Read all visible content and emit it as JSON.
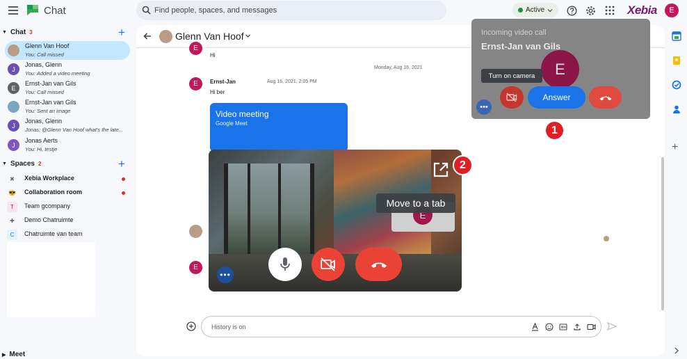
{
  "app": {
    "title": "Chat"
  },
  "search": {
    "placeholder": "Find people, spaces, and messages"
  },
  "status": {
    "label": "Active"
  },
  "brand": {
    "name": "Xebia"
  },
  "account": {
    "initial": "E"
  },
  "sidebar": {
    "chat": {
      "label": "Chat",
      "count": "3"
    },
    "chats": [
      {
        "name": "Glenn Van Hoof",
        "preview": "You: Call missed",
        "color": "#b89c84",
        "initial": ""
      },
      {
        "name": "Jonas, Glenn",
        "preview": "You: Added a video meeting",
        "color": "#6a4fb5",
        "initial": "J"
      },
      {
        "name": "Ernst-Jan van Gils",
        "preview": "You: Call missed",
        "color": "#5f6368",
        "initial": "E"
      },
      {
        "name": "Ernst-Jan van Gils",
        "preview": "You: Sent an image",
        "color": "#7aa6c2",
        "initial": ""
      },
      {
        "name": "Jonas, Glenn",
        "preview": "Jonas: @Glenn Van Hoof what's the late...",
        "color": "#6a4fb5",
        "initial": "J"
      },
      {
        "name": "Jonas Aerts",
        "preview": "You: Hi, testje",
        "color": "#7e57c2",
        "initial": "J"
      }
    ],
    "spaces": {
      "label": "Spaces",
      "count": "2"
    },
    "space_items": [
      {
        "name": "Xebia Workplace",
        "icon": "✖",
        "bg": "transparent",
        "fg": "#5f6368",
        "bold": true,
        "unread": true
      },
      {
        "name": "Collaboration room",
        "icon": "😎",
        "bg": "transparent",
        "fg": "#000",
        "bold": true,
        "unread": true
      },
      {
        "name": "Team gcompany",
        "icon": "T",
        "bg": "#fce4ec",
        "fg": "#c2185b",
        "bold": false,
        "unread": false
      },
      {
        "name": "Demo Chatruimte",
        "icon": "✚",
        "bg": "transparent",
        "fg": "#5f6368",
        "bold": false,
        "unread": false
      },
      {
        "name": "Chatruimte van team",
        "icon": "C",
        "bg": "#e3f2fd",
        "fg": "#1a73e8",
        "bold": false,
        "unread": false
      }
    ],
    "meet": {
      "label": "Meet"
    }
  },
  "conversation": {
    "name": "Glenn Van Hoof",
    "hi_text": "Hi",
    "date_divider": "Monday, Aug 16, 2021",
    "sender": "Ernst-Jan",
    "timestamp": "Aug 16, 2021, 2:05 PM",
    "message": "Hi ber",
    "meeting_title": "Video meeting",
    "meeting_subtitle": "Google Meet",
    "avatar_initial": "E"
  },
  "composer": {
    "placeholder": "History is on"
  },
  "video": {
    "tooltip": "Move to a tab",
    "self_initial": "E",
    "more": "•••"
  },
  "incoming": {
    "label": "Incoming video call",
    "caller": "Ernst-Jan van Gils",
    "initial": "E",
    "camera_tooltip": "Turn on camera",
    "answer": "Answer",
    "more": "•••"
  },
  "callouts": [
    "1",
    "2"
  ]
}
